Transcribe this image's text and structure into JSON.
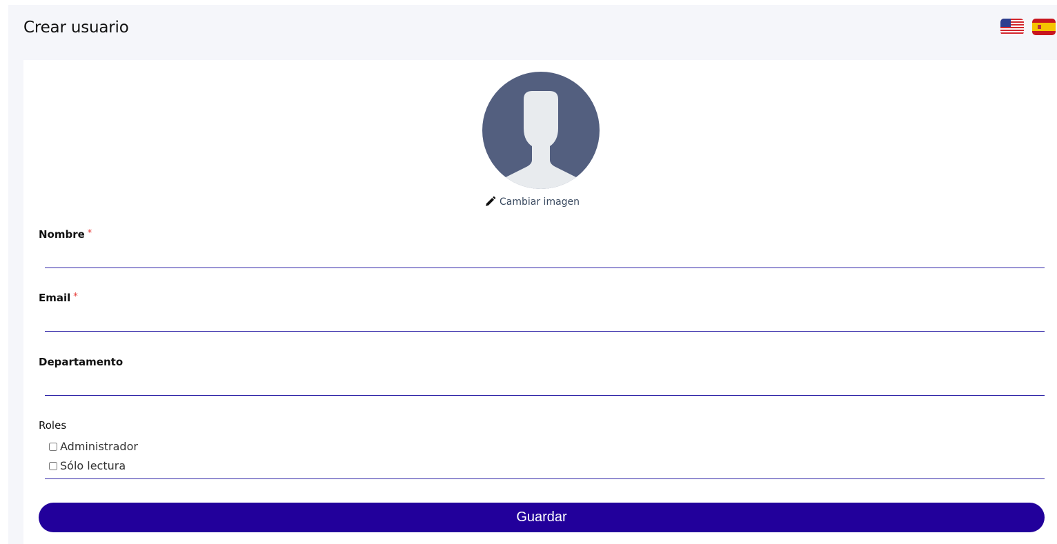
{
  "header": {
    "title": "Crear usuario",
    "languages": [
      {
        "code": "en",
        "icon": "us-flag-icon"
      },
      {
        "code": "es",
        "icon": "es-flag-icon"
      }
    ]
  },
  "avatar": {
    "icon": "user-silhouette-icon",
    "change_label": "Cambiar imagen",
    "change_icon": "pencil-icon"
  },
  "form": {
    "name": {
      "label": "Nombre",
      "required_mark": "*",
      "value": ""
    },
    "email": {
      "label": "Email",
      "required_mark": "*",
      "value": ""
    },
    "department": {
      "label": "Departamento",
      "value": ""
    },
    "roles": {
      "label": "Roles",
      "options": [
        {
          "label": "Administrador",
          "checked": false
        },
        {
          "label": "Sólo lectura",
          "checked": false
        }
      ]
    },
    "save_label": "Guardar"
  },
  "colors": {
    "primary": "#22009b",
    "underline": "#2a1fa5",
    "required": "#e53935",
    "avatar_bg": "#535f7f",
    "avatar_figure": "#e8ebee"
  }
}
